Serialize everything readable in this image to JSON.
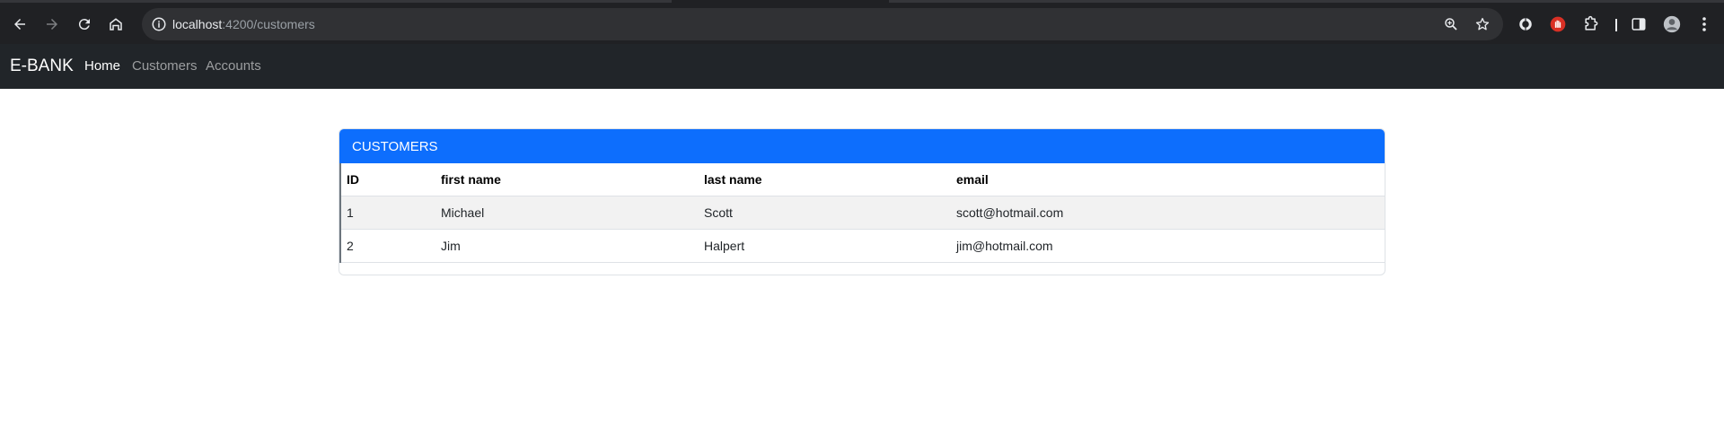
{
  "browser": {
    "url_host": "localhost",
    "url_path": ":4200/customers",
    "icons": [
      "back-arrow-icon",
      "forward-arrow-icon",
      "reload-icon",
      "home-icon",
      "site-info-icon",
      "zoom-icon",
      "bookmark-star-icon",
      "extension-icon",
      "side-panel-icon",
      "profile-avatar",
      "menu-kebab-icon"
    ]
  },
  "navbar": {
    "brand": "E-BANK",
    "links": [
      "Home",
      "Customers",
      "Accounts"
    ],
    "active_index": 0
  },
  "card": {
    "title": "CUSTOMERS",
    "columns": [
      "ID",
      "first name",
      "last name",
      "email"
    ],
    "rows": [
      [
        "1",
        "Michael",
        "Scott",
        "scott@hotmail.com"
      ],
      [
        "2",
        "Jim",
        "Halpert",
        "jim@hotmail.com"
      ]
    ]
  },
  "colors": {
    "chrome_bg": "#202124",
    "navbar_bg": "#212529",
    "card_header": "#0d6efd"
  }
}
